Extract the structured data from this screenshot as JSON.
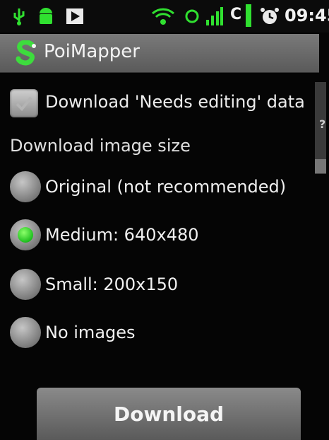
{
  "status_bar": {
    "carrier": "C",
    "time": "09:45",
    "icons": [
      "usb-icon",
      "android-icon",
      "play-icon",
      "wifi-icon",
      "sync-icon",
      "signal-icon",
      "battery-icon",
      "alarm-icon"
    ],
    "accent": "#30e030"
  },
  "app": {
    "title": "PoiMapper"
  },
  "options": {
    "needs_editing_label": "Download 'Needs editing' data",
    "needs_editing_checked": true,
    "image_size_label": "Download image size",
    "image_sizes": [
      {
        "label": "Original (not recommended)",
        "checked": false
      },
      {
        "label": "Medium: 640x480",
        "checked": true
      },
      {
        "label": "Small: 200x150",
        "checked": false
      },
      {
        "label": "No images",
        "checked": false
      }
    ]
  },
  "actions": {
    "download_label": "Download"
  }
}
